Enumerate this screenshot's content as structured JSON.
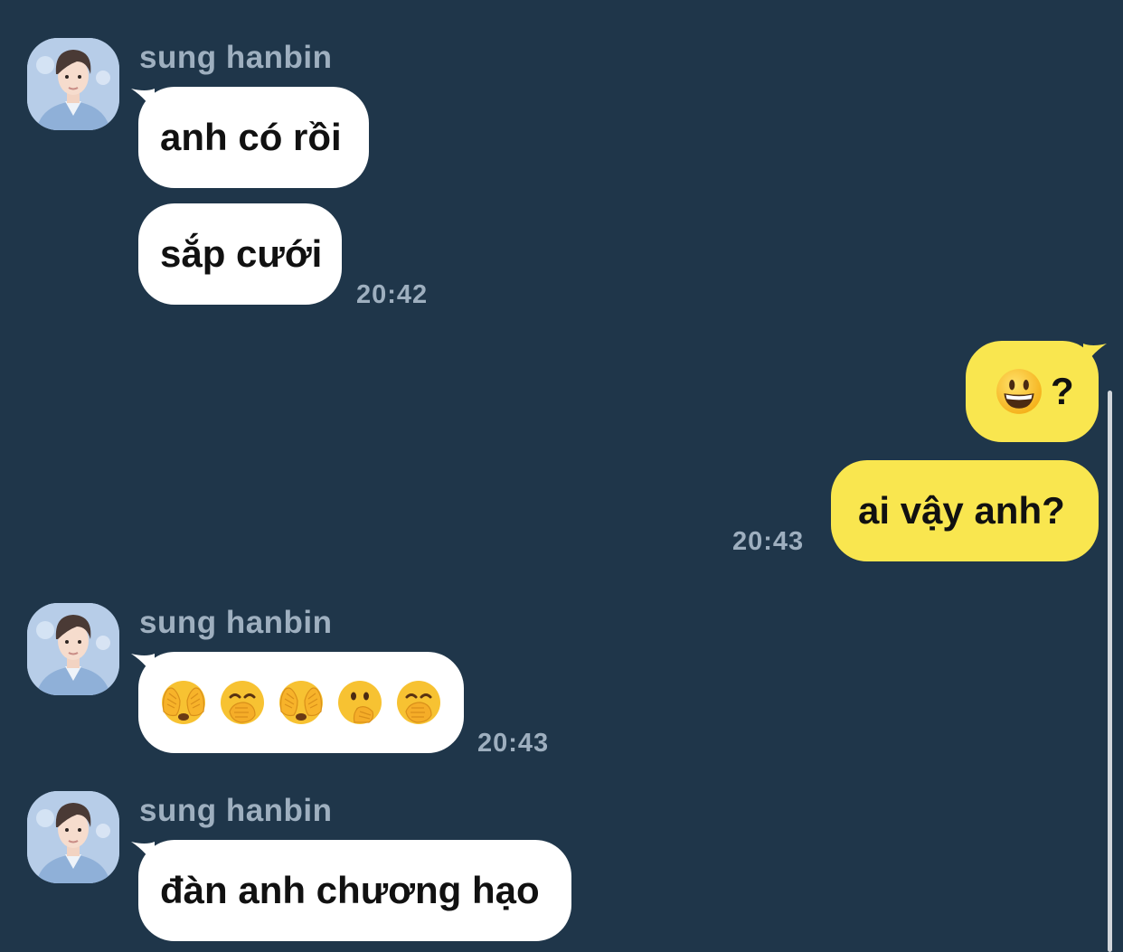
{
  "contact": {
    "name": "sung hanbin"
  },
  "messages": [
    {
      "id": "m1",
      "direction": "incoming",
      "text": "anh có rồi"
    },
    {
      "id": "m2",
      "direction": "incoming",
      "text": "sắp cưới",
      "time": "20:42"
    },
    {
      "id": "m3",
      "direction": "outgoing",
      "emoji": "grinning-face-emoji",
      "text": "?"
    },
    {
      "id": "m4",
      "direction": "outgoing",
      "text": "ai vậy anh?",
      "time": "20:43"
    },
    {
      "id": "m5",
      "direction": "incoming",
      "emoji_sequence": [
        "see-no-evil-face-emoji",
        "hand-over-mouth-emoji",
        "see-no-evil-face-emoji",
        "open-hand-over-mouth-emoji",
        "hand-over-mouth-emoji"
      ],
      "time": "20:43"
    },
    {
      "id": "m6",
      "direction": "incoming",
      "text": "đàn anh chương hạo"
    }
  ],
  "colors": {
    "background": "#1f364a",
    "incoming_bubble": "#ffffff",
    "outgoing_bubble": "#f9e64f",
    "meta_text": "#9eafbf",
    "message_text": "#111111"
  }
}
